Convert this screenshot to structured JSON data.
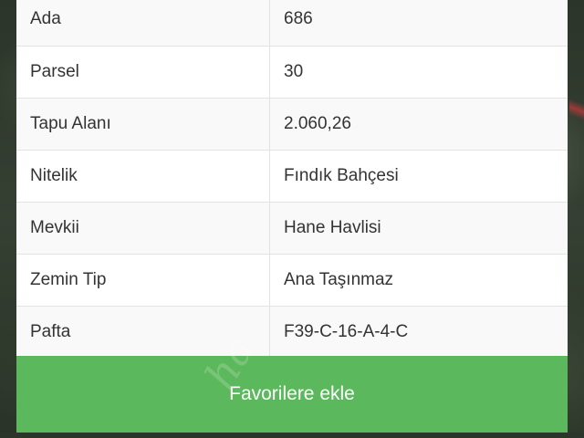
{
  "table": {
    "rows": [
      {
        "label": "Ada",
        "value": "686"
      },
      {
        "label": "Parsel",
        "value": "30"
      },
      {
        "label": "Tapu Alanı",
        "value": "2.060,26"
      },
      {
        "label": "Nitelik",
        "value": "Fındık Bahçesi"
      },
      {
        "label": "Mevkii",
        "value": "Hane Havlisi"
      },
      {
        "label": "Zemin Tip",
        "value": "Ana Taşınmaz"
      },
      {
        "label": "Pafta",
        "value": "F39-C-16-A-4-C"
      }
    ]
  },
  "actions": {
    "favorite_label": "Favorilere ekle"
  },
  "colors": {
    "button_green": "#5cb85c",
    "text": "#333333",
    "border": "#e3e3e3"
  }
}
